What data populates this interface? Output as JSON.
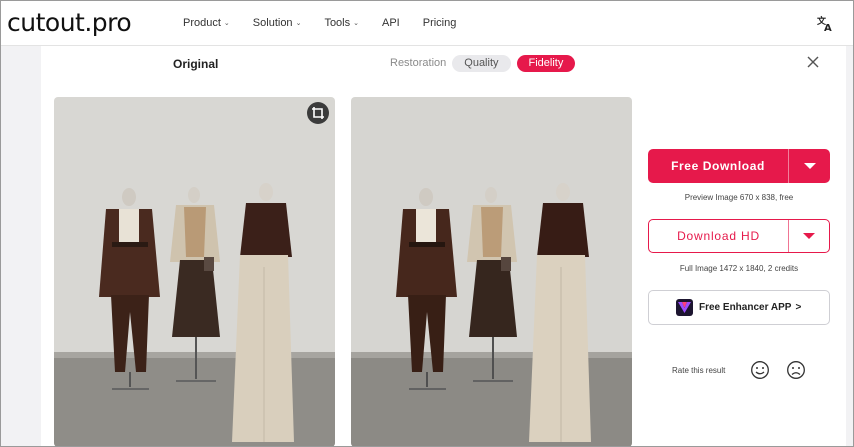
{
  "brand": {
    "logo_text": "cutout.pro"
  },
  "nav": {
    "items": [
      {
        "label": "Product",
        "has_dropdown": true
      },
      {
        "label": "Solution",
        "has_dropdown": true
      },
      {
        "label": "Tools",
        "has_dropdown": true
      },
      {
        "label": "API",
        "has_dropdown": false
      },
      {
        "label": "Pricing",
        "has_dropdown": false
      }
    ],
    "language_icon": "translate-icon"
  },
  "viewer": {
    "original_label": "Original",
    "mode_tabs": [
      {
        "label": "Restoration",
        "state": "plain"
      },
      {
        "label": "Quality",
        "state": "inactive"
      },
      {
        "label": "Fidelity",
        "state": "active"
      }
    ],
    "close_icon": "close-icon",
    "crop_icon": "crop-icon"
  },
  "download": {
    "free_label": "Free Download",
    "free_note": "Preview Image 670 x 838, free",
    "hd_label": "Download HD",
    "hd_note": "Full Image 1472 x 1840, 2 credits",
    "app_label": "Free Enhancer APP",
    "app_chevron": ">"
  },
  "rating": {
    "label": "Rate this result"
  },
  "colors": {
    "accent": "#e6194b",
    "page_bg": "#f2f2f4",
    "photo_bg": "#d6d5d1"
  }
}
